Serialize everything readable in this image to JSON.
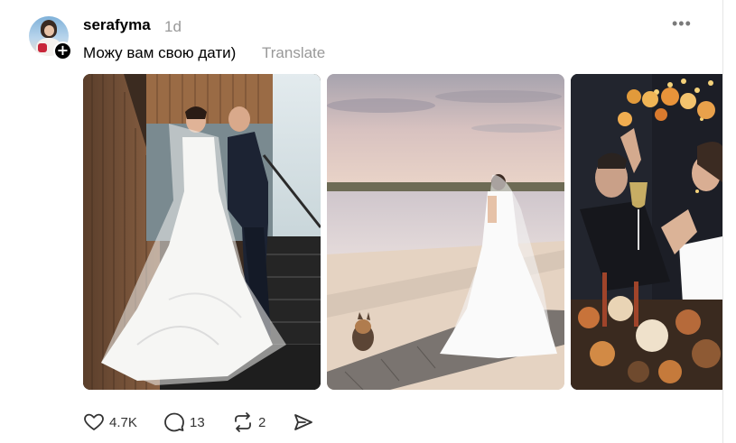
{
  "post": {
    "username": "serafyma",
    "time": "1d",
    "caption": "Можу вам свою дати)",
    "translate_label": "Translate",
    "more_label": "•••",
    "follow_symbol": "+",
    "images": [
      {
        "description_icon": "photo-wedding-stairs"
      },
      {
        "description_icon": "photo-wedding-beach"
      },
      {
        "description_icon": "photo-wedding-party"
      }
    ]
  },
  "actions": {
    "likes": "4.7K",
    "replies": "13",
    "reposts": "2"
  },
  "icons": {
    "like": "heart-icon",
    "reply": "comment-icon",
    "repost": "repost-icon",
    "share": "share-icon"
  }
}
